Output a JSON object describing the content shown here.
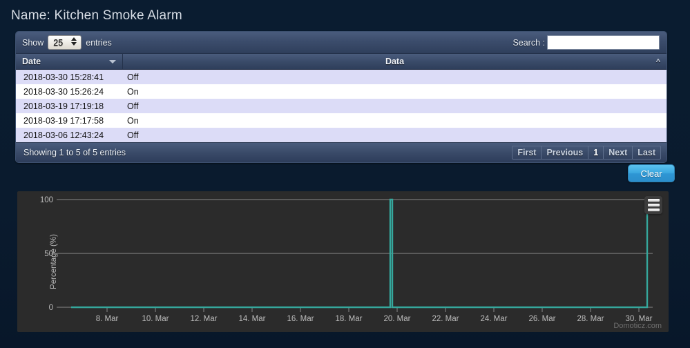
{
  "page": {
    "title": "Name: Kitchen Smoke Alarm",
    "background_color": "#0a1b2e"
  },
  "table": {
    "length_label_before": "Show",
    "length_label_after": "entries",
    "length_value": "25",
    "search_label": "Search :",
    "search_value": "",
    "search_placeholder": "",
    "columns": [
      {
        "key": "date",
        "label": "Date",
        "sort": "desc"
      },
      {
        "key": "data",
        "label": "Data",
        "sort": "asc-indicator"
      }
    ],
    "rows": [
      {
        "date": "2018-03-30 15:28:41",
        "data": "Off"
      },
      {
        "date": "2018-03-30 15:26:24",
        "data": "On"
      },
      {
        "date": "2018-03-19 17:19:18",
        "data": "Off"
      },
      {
        "date": "2018-03-19 17:17:58",
        "data": "On"
      },
      {
        "date": "2018-03-06 12:43:24",
        "data": "Off"
      }
    ],
    "showing_text": "Showing 1 to 5 of 5 entries",
    "paging": {
      "first": "First",
      "previous": "Previous",
      "current": "1",
      "next": "Next",
      "last": "Last"
    }
  },
  "actions": {
    "clear_label": "Clear"
  },
  "chart_panel": {
    "menu_icon": "hamburger-menu-icon",
    "watermark": "Domoticz.com",
    "accent_color": "#35a79c",
    "background_color": "#2b2b2b",
    "gridline_color": "#8a8a8a"
  },
  "chart_data": {
    "type": "line",
    "title": "",
    "xlabel": "",
    "ylabel": "Percentage (%)",
    "ylim": [
      0,
      100
    ],
    "yticks": [
      0,
      50,
      100
    ],
    "ytick_labels": [
      "0",
      "50",
      "100"
    ],
    "xtick_labels": [
      "8. Mar",
      "10. Mar",
      "12. Mar",
      "14. Mar",
      "16. Mar",
      "18. Mar",
      "20. Mar",
      "22. Mar",
      "24. Mar",
      "26. Mar",
      "28. Mar",
      "30. Mar"
    ],
    "grid": true,
    "legend": "none",
    "series": [
      {
        "name": "Percentage",
        "color": "#35a79c",
        "x": [
          "6. Mar",
          "19. Mar",
          "19. Mar",
          "19. Mar",
          "19. Mar",
          "30. Mar",
          "30. Mar"
        ],
        "values": [
          0,
          0,
          100,
          100,
          0,
          0,
          100
        ],
        "description": "Flat at 0% with two narrow vertical spikes to 100% near 19-20 Mar and at 30 Mar (remaining at 100 at the right edge)"
      }
    ]
  }
}
